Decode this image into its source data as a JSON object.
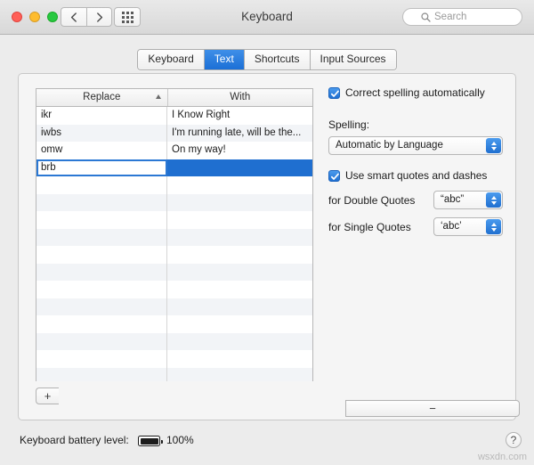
{
  "window": {
    "title": "Keyboard",
    "traffic_lights": [
      "close",
      "minimize",
      "zoom"
    ],
    "nav": {
      "back": "back-chevron",
      "forward": "forward-chevron",
      "grid": "show-all-grid"
    },
    "search": {
      "placeholder": "Search",
      "value": "",
      "icon": "search-icon"
    }
  },
  "tabs": [
    {
      "label": "Keyboard",
      "active": false
    },
    {
      "label": "Text",
      "active": true
    },
    {
      "label": "Shortcuts",
      "active": false
    },
    {
      "label": "Input Sources",
      "active": false
    }
  ],
  "table": {
    "columns": [
      "Replace",
      "With"
    ],
    "sort_indicator": "caret-up-icon",
    "rows": [
      {
        "replace": "ikr",
        "with": "I Know Right",
        "selected": false,
        "editing": false
      },
      {
        "replace": "iwbs",
        "with": "I'm running late, will be the...",
        "selected": false,
        "editing": false
      },
      {
        "replace": "omw",
        "with": "On my way!",
        "selected": false,
        "editing": false
      },
      {
        "replace": "brb",
        "with": "",
        "selected": true,
        "editing": true
      }
    ],
    "empty_row_count": 13,
    "add_button": "+",
    "remove_button": "−"
  },
  "options": {
    "correct_spelling": {
      "label": "Correct spelling automatically",
      "checked": true
    },
    "spelling_label": "Spelling:",
    "spelling_value": "Automatic by Language",
    "smart_quotes": {
      "label": "Use smart quotes and dashes",
      "checked": true
    },
    "double_quotes_label": "for Double Quotes",
    "double_quotes_value": "“abc”",
    "single_quotes_label": "for Single Quotes",
    "single_quotes_value": "‘abc’"
  },
  "footer": {
    "battery_label": "Keyboard battery level:",
    "battery_percent": "100%",
    "battery_fill": 100,
    "help": "?",
    "watermark": "wsxdn.com"
  },
  "colors": {
    "accent": "#1f6fd0",
    "selection": "#1f6fd0",
    "window_bg": "#ececec",
    "panel_bg": "#f5f5f5"
  }
}
